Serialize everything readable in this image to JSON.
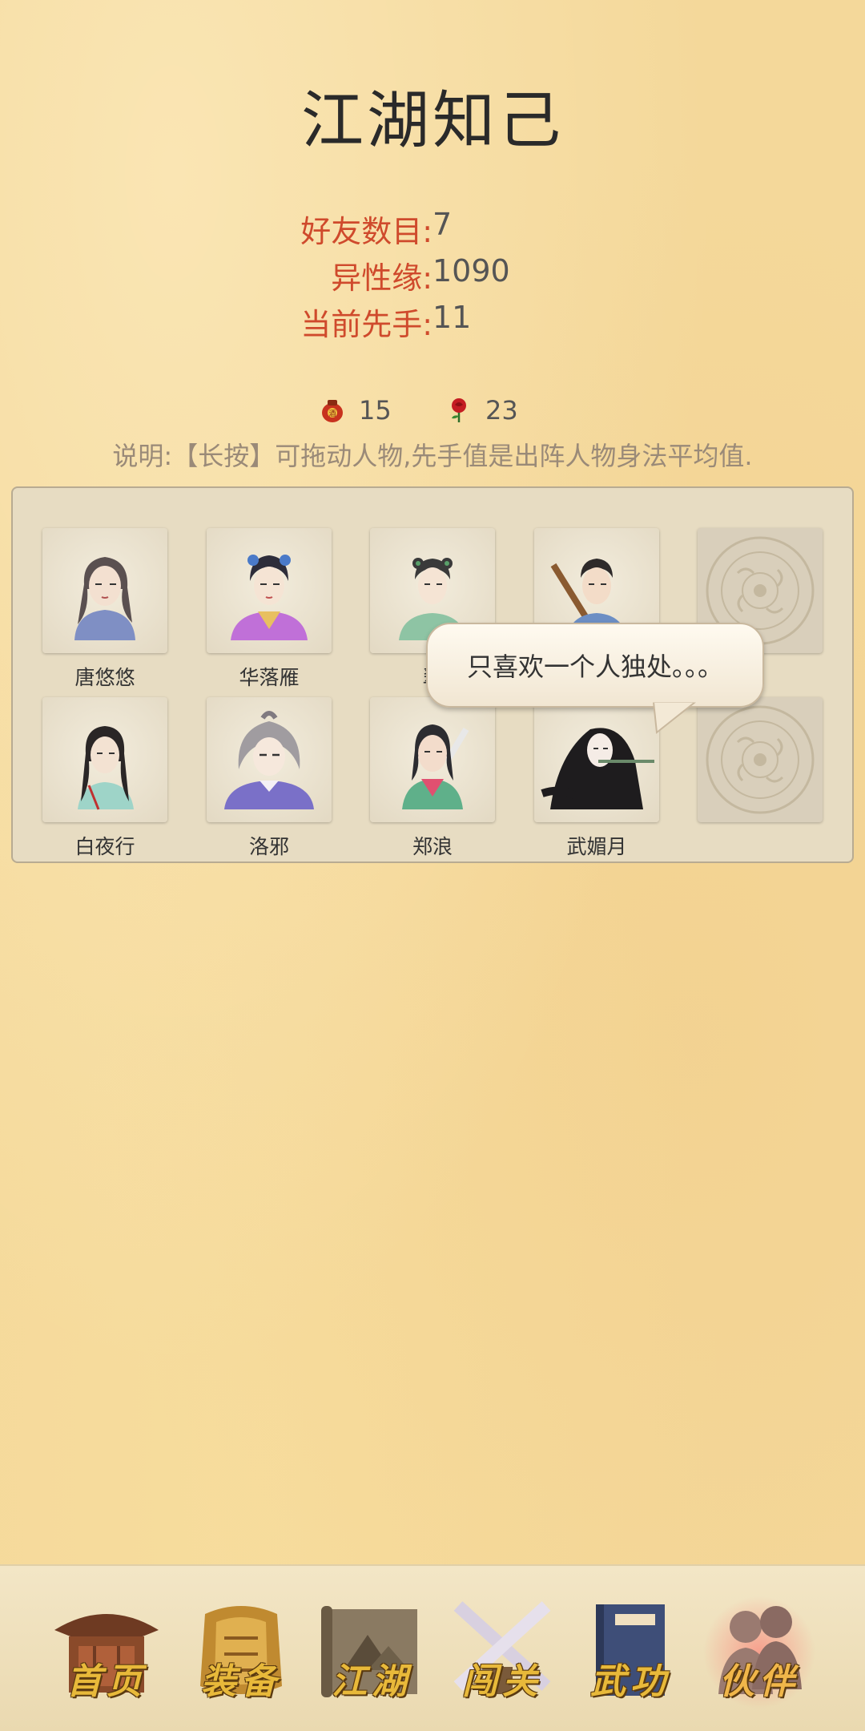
{
  "page": {
    "title": "江湖知己"
  },
  "stats": [
    {
      "label": "好友数目:",
      "value": "7"
    },
    {
      "label": "异性缘:",
      "value": "1090"
    },
    {
      "label": "当前先手:",
      "value": "11"
    }
  ],
  "currency": [
    {
      "icon": "wine-jar-icon",
      "value": "15"
    },
    {
      "icon": "rose-icon",
      "value": "23"
    }
  ],
  "note": "说明:【长按】可拖动人物,先手值是出阵人物身法平均值.",
  "partners": [
    {
      "name": "唐悠悠"
    },
    {
      "name": "华落雁"
    },
    {
      "name": "翠"
    },
    {
      "name": ""
    },
    {
      "name": "白夜行"
    },
    {
      "name": "洛邪"
    },
    {
      "name": "郑浪"
    },
    {
      "name": "武媚月"
    }
  ],
  "bubble": {
    "text": "只喜欢一个人独处。。。"
  },
  "nav": [
    {
      "label": "首页",
      "icon": "pavilion-icon"
    },
    {
      "label": "装备",
      "icon": "armor-icon"
    },
    {
      "label": "江湖",
      "icon": "scroll-map-icon"
    },
    {
      "label": "闯关",
      "icon": "crossed-swords-icon"
    },
    {
      "label": "武功",
      "icon": "martial-book-icon"
    },
    {
      "label": "伙伴",
      "icon": "companions-icon",
      "active": true
    }
  ],
  "colors": {
    "accent": "#cf4a2c",
    "background": "#f4d89a",
    "nav_label": "#e8b93a"
  }
}
